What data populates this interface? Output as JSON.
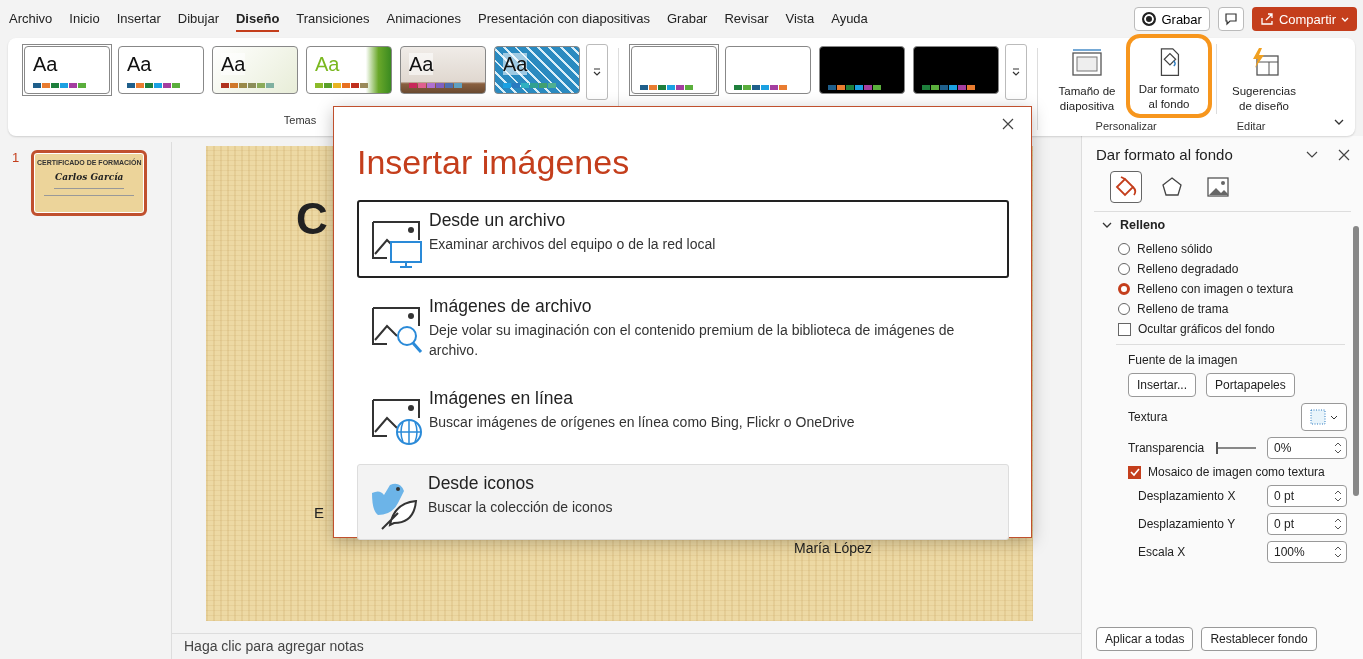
{
  "menu": {
    "tabs": [
      {
        "label": "Archivo",
        "selected": false
      },
      {
        "label": "Inicio",
        "selected": false
      },
      {
        "label": "Insertar",
        "selected": false
      },
      {
        "label": "Dibujar",
        "selected": false
      },
      {
        "label": "Diseño",
        "selected": true
      },
      {
        "label": "Transiciones",
        "selected": false
      },
      {
        "label": "Animaciones",
        "selected": false
      },
      {
        "label": "Presentación con diapositivas",
        "selected": false
      },
      {
        "label": "Grabar",
        "selected": false
      },
      {
        "label": "Revisar",
        "selected": false
      },
      {
        "label": "Vista",
        "selected": false
      },
      {
        "label": "Ayuda",
        "selected": false
      }
    ],
    "record_button": "Grabar",
    "share_button": "Compartir"
  },
  "ribbon": {
    "themes": [
      {
        "label": "Aa",
        "selected": true,
        "kind": "plain"
      },
      {
        "label": "Aa",
        "selected": false,
        "kind": "plain"
      },
      {
        "label": "Aa",
        "selected": false,
        "kind": "cream"
      },
      {
        "label": "Aa",
        "selected": false,
        "kind": "green"
      },
      {
        "label": "Aa",
        "selected": false,
        "kind": "wood"
      },
      {
        "label": "Aa",
        "selected": false,
        "kind": "pattern"
      }
    ],
    "themes_group": "Temas",
    "variants": [
      {
        "dark": false,
        "selected": true
      },
      {
        "dark": false,
        "selected": false
      },
      {
        "dark": true,
        "selected": false
      },
      {
        "dark": true,
        "selected": false
      }
    ],
    "commands": [
      {
        "kind": "size",
        "label": "Tamaño de diapositiva",
        "highlighted": false
      },
      {
        "kind": "background",
        "label": "Dar formato al fondo",
        "highlighted": true
      },
      {
        "kind": "designer",
        "label": "Sugerencias de diseño",
        "highlighted": false
      }
    ],
    "groups": [
      {
        "label": "Personalizar"
      },
      {
        "label": "Editar"
      }
    ]
  },
  "thumbnail": {
    "number": "1",
    "selected": true,
    "title": "CERTIFICADO DE FORMACIÓN",
    "name": "Carlos García"
  },
  "slide": {
    "title_fragment": "C",
    "text_fragment": "E",
    "signature": "María López"
  },
  "notes": {
    "placeholder": "Haga clic para agregar notas"
  },
  "dialog": {
    "title": "Insertar imágenes",
    "options": [
      {
        "kind": "file",
        "title": "Desde un archivo",
        "description": "Examinar archivos del equipo o de la red local",
        "selected": true,
        "hovered": false
      },
      {
        "kind": "stock",
        "title": "Imágenes de archivo",
        "description": "Deje volar su imaginación con el contenido premium de la biblioteca de imágenes de archivo.",
        "selected": false,
        "hovered": false
      },
      {
        "kind": "online",
        "title": "Imágenes en línea",
        "description": "Buscar imágenes de orígenes en línea como Bing, Flickr o OneDrive",
        "selected": false,
        "hovered": false
      },
      {
        "kind": "icons",
        "title": "Desde iconos",
        "description": "Buscar la colección de iconos",
        "selected": false,
        "hovered": true
      }
    ]
  },
  "pane": {
    "title": "Dar formato al fondo",
    "section": "Relleno",
    "expanded": true,
    "fill_options": [
      {
        "label": "Relleno sólido",
        "selected": false
      },
      {
        "label": "Relleno degradado",
        "selected": false
      },
      {
        "label": "Relleno con imagen o textura",
        "selected": true
      },
      {
        "label": "Relleno de trama",
        "selected": false
      }
    ],
    "hide_graphics": {
      "label": "Ocultar gráficos del fondo",
      "checked": false
    },
    "source_label": "Fuente de la imagen",
    "source_buttons": [
      "Insertar...",
      "Portapapeles"
    ],
    "texture_label": "Textura",
    "transparency_label": "Transparencia",
    "transparency": {
      "level": 0
    },
    "transparency_value": "0%",
    "tile": {
      "label": "Mosaico de imagen como textura",
      "checked": true
    },
    "fields": [
      {
        "label": "Desplazamiento X",
        "value": "0 pt"
      },
      {
        "label": "Desplazamiento Y",
        "value": "0 pt"
      },
      {
        "label": "Escala X",
        "value": "100%"
      }
    ],
    "footer_buttons": [
      "Aplicar a todas",
      "Restablecer fondo"
    ]
  }
}
